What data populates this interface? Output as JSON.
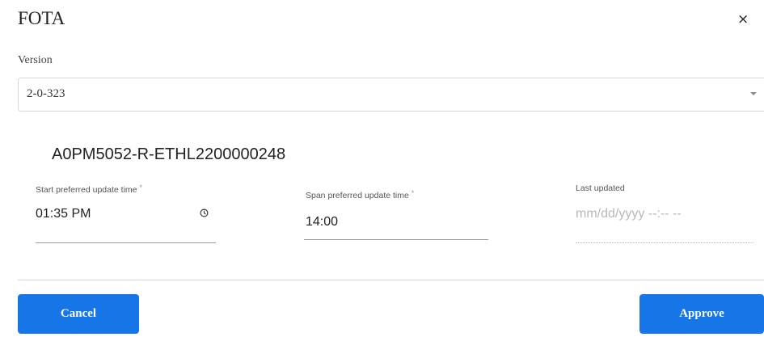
{
  "dialog": {
    "title": "FOTA",
    "close_label": "×"
  },
  "version": {
    "label": "Version",
    "selected": "2-0-323"
  },
  "device": {
    "id": "A0PM5052-R-ETHL2200000248"
  },
  "fields": {
    "start_time": {
      "label": "Start preferred update time",
      "required_marker": "*",
      "value": "01:35 PM",
      "icon": "clock-icon"
    },
    "span_time": {
      "label": "Span preferred update time",
      "required_marker": "*",
      "value": "14:00"
    },
    "last_updated": {
      "label": "Last updated",
      "placeholder": "mm/dd/yyyy --:-- --"
    }
  },
  "actions": {
    "cancel_label": "Cancel",
    "approve_label": "Approve"
  },
  "colors": {
    "primary": "#1676e8",
    "divider": "#d6d6d6",
    "text": "#222222"
  }
}
